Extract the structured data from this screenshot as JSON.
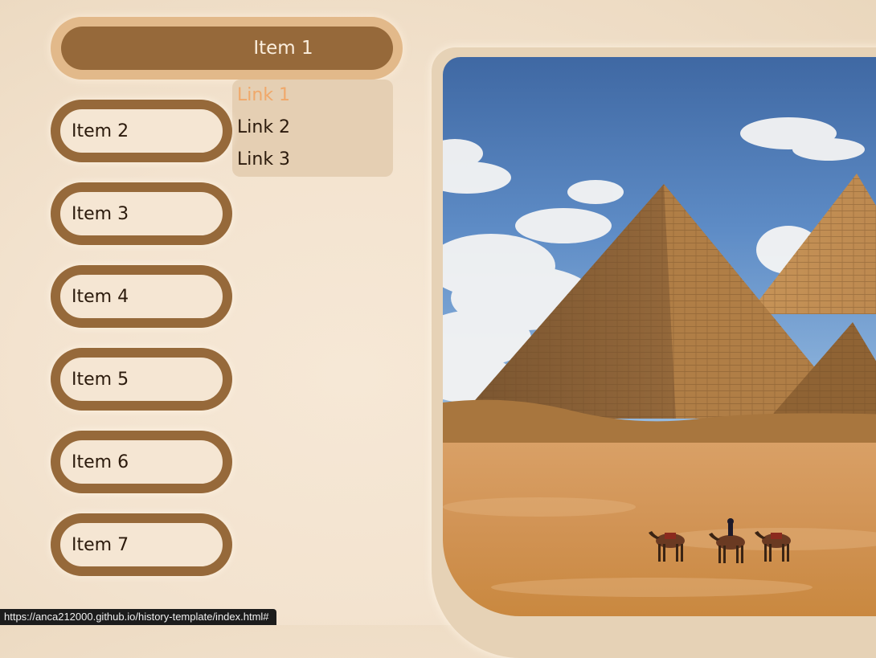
{
  "nav": {
    "active_item": "Item 1",
    "items": [
      "Item 2",
      "Item 3",
      "Item 4",
      "Item 5",
      "Item 6",
      "Item 7"
    ]
  },
  "dropdown": {
    "links": [
      "Link 1",
      "Link 2",
      "Link 3"
    ],
    "hovered": "Link 1"
  },
  "hero": {
    "image": "pyramids-of-giza-with-camels"
  },
  "status_bar": {
    "url": "https://anca212000.github.io/history-template/index.html#"
  },
  "colors": {
    "page_bg": "#f3e3cf",
    "nav_brown": "#96693a",
    "nav_active_ring": "#e2b98a",
    "dropdown_bg": "#e5cfb3",
    "link_hover": "#f0a86a",
    "frame": "#e6d2b6"
  }
}
